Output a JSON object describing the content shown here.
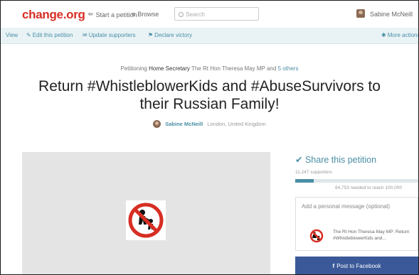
{
  "header": {
    "logo": "change.org",
    "nav": {
      "start_petition": "Start a petition",
      "browse": "Browse"
    },
    "search": {
      "placeholder": "Search"
    },
    "user": {
      "name": "Sabine McNeill"
    }
  },
  "actions": {
    "view": "View",
    "edit": "Edit this petition",
    "update": "Update supporters",
    "declare": "Declare victory",
    "more": "More actions"
  },
  "petition": {
    "petitioning_prefix": "Petitioning",
    "petitioning_target": "Home Secretary",
    "petitioning_name": "The Rt Hon Theresa May MP",
    "petitioning_and": "and",
    "petitioning_others": "5 others",
    "title": "Return #WhistleblowerKids and #AbuseSurvivors to their Russian Family!",
    "author_name": "Sabine McNeill",
    "author_location": "London, United Kingdom"
  },
  "share": {
    "title": "Share this petition",
    "supporters": "11,247 supporters",
    "progress_fraction": 0.15,
    "needed": "84,753 needed to reach 100,000",
    "message_placeholder": "Add a personal message (optional)",
    "preview_text": "The Rt Hon Theresa May MP: Return #WhistleblowerKids and...",
    "facebook_button": "Post to Facebook"
  },
  "colors": {
    "brand_red": "#d72e24",
    "link_teal": "#4a8ea5",
    "action_bar_bg": "#e9f3f6",
    "facebook_blue": "#3b5998"
  },
  "icons": {
    "start_petition": "pencil-icon",
    "browse": "menu-icon",
    "search": "search-icon",
    "share": "check-icon",
    "facebook": "facebook-icon"
  }
}
